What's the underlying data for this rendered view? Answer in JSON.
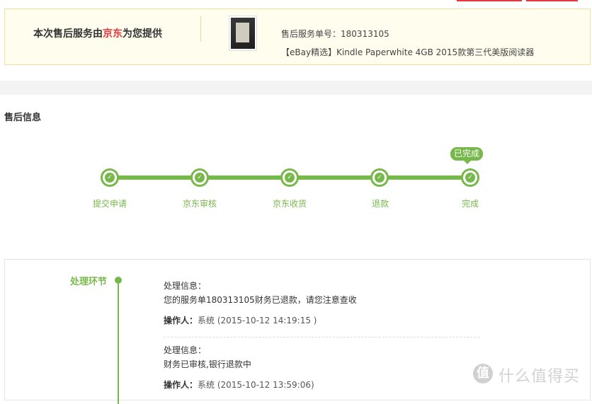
{
  "header": {
    "provider_prefix": "本次售后服务由",
    "provider_brand": "京东",
    "provider_suffix": "为您提供",
    "service_label": "售后服务单号：",
    "service_number": "180313105",
    "product_title": "【eBay精选】Kindle Paperwhite 4GB 2015款第三代美版阅读器"
  },
  "section_title": "售后信息",
  "progress": {
    "current_bubble": "已完成",
    "steps": [
      "提交申请",
      "京东审核",
      "京东收货",
      "退款",
      "完成"
    ]
  },
  "process": {
    "label": "处理环节",
    "records": [
      {
        "info_label": "处理信息：",
        "info_text": "您的服务单180313105财务已退款，请您注意查收",
        "op_label": "操作人：",
        "op_text": "系统 (2015-10-12 14:19:15 )"
      },
      {
        "info_label": "处理信息：",
        "info_text": "财务已审核,银行退款中",
        "op_label": "操作人：",
        "op_text": "系统 (2015-10-12 13:59:06)"
      }
    ]
  },
  "watermark": {
    "icon": "值",
    "text": "什么值得买"
  },
  "colors": {
    "accent_green": "#77b84a",
    "brand_red": "#e4393c"
  }
}
